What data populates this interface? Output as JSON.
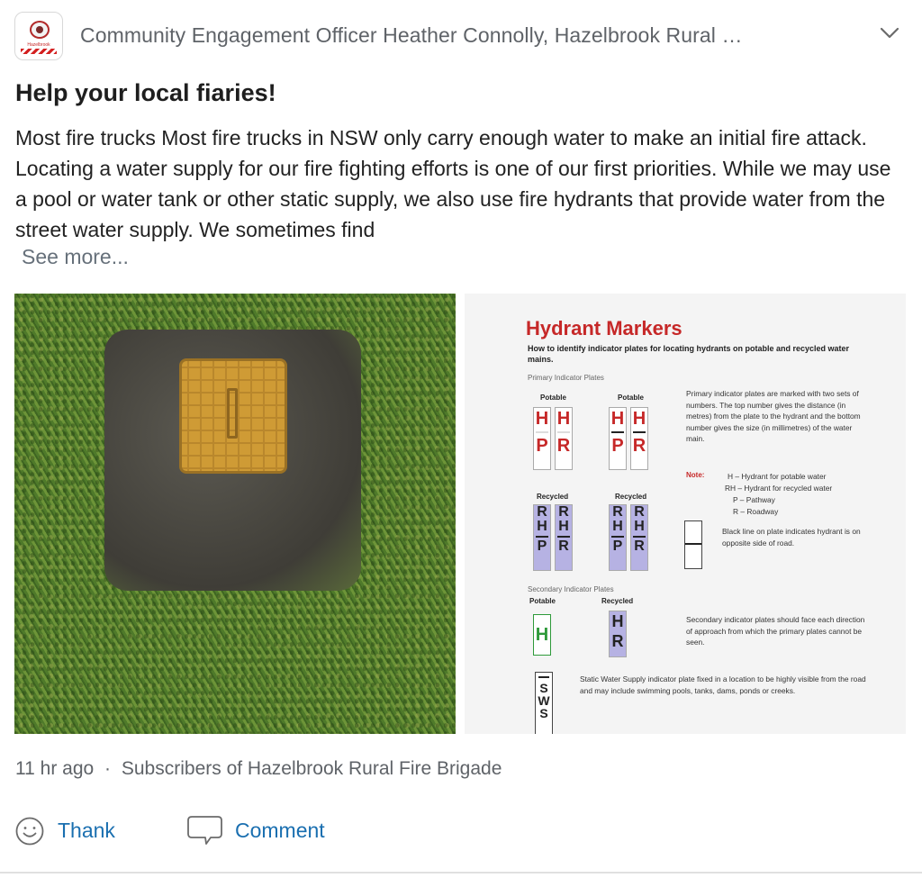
{
  "header": {
    "author": "Community Engagement Officer Heather Connolly, Hazelbrook Rural …",
    "logo_text": "Hazelbrook",
    "menu_icon": "chevron-down-icon"
  },
  "post": {
    "title": "Help your local fiaries!",
    "body": "Most fire trucks Most fire trucks in NSW only carry enough water to make an initial fire attack. Locating a water supply for our fire fighting efforts is one of our first priorities. While we may use a pool or water tank or other static supply, we also use fire hydrants that provide water from the street water supply. We sometimes find",
    "see_more": "See more..."
  },
  "infographic": {
    "title": "Hydrant Markers",
    "subtitle": "How to identify indicator plates for locating hydrants on potable and recycled water mains.",
    "primary_heading": "Primary Indicator Plates",
    "potable": "Potable",
    "recycled": "Recycled",
    "primary_desc": "Primary indicator plates are marked with two sets of numbers. The top number gives the distance (in metres) from the plate to the hydrant and the bottom number gives the size (in millimetres) of the water main.",
    "note_label": "Note:",
    "note_lines": [
      "H – Hydrant for potable water",
      "RH – Hydrant for recycled water",
      "P – Pathway",
      "R – Roadway"
    ],
    "black_line_desc": "Black line on plate indicates hydrant is on opposite side of road.",
    "secondary_heading": "Secondary Indicator Plates",
    "secondary_desc": "Secondary indicator plates should face each direction of approach from which the primary plates cannot be seen.",
    "static_desc": "Static Water Supply indicator plate fixed in a location to be highly visible from the road and may include swimming pools, tanks, dams, ponds or creeks."
  },
  "meta": {
    "time": "11 hr ago",
    "separator": "·",
    "audience": "Subscribers of Hazelbrook Rural Fire Brigade"
  },
  "actions": {
    "thank_label": "Thank",
    "thank_icon": "smiley-icon",
    "comment_label": "Comment",
    "comment_icon": "speech-bubble-icon"
  },
  "colors": {
    "link": "#1a6fb0",
    "meta": "#5f6368",
    "hydrant_red": "#c62828",
    "recycled_purple": "#b6b2e3"
  }
}
